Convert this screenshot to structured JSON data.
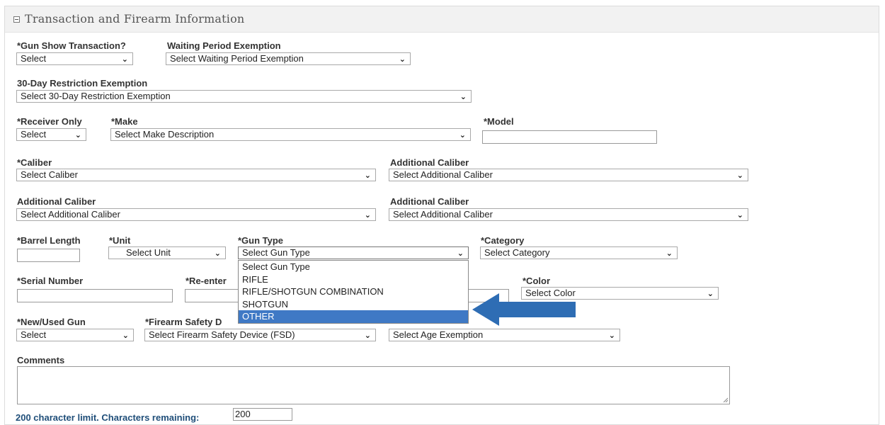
{
  "section": {
    "title": "Transaction and Firearm Information"
  },
  "fields": {
    "gun_show": {
      "label": "*Gun Show Transaction?",
      "value": "Select"
    },
    "waiting_period": {
      "label": "Waiting Period Exemption",
      "value": "Select Waiting Period Exemption"
    },
    "restriction_30": {
      "label": "30-Day Restriction Exemption",
      "value": "Select 30-Day Restriction Exemption"
    },
    "receiver_only": {
      "label": "*Receiver Only",
      "value": "Select"
    },
    "make": {
      "label": "*Make",
      "value": "Select Make Description"
    },
    "model": {
      "label": "*Model",
      "value": ""
    },
    "caliber": {
      "label": "*Caliber",
      "value": "Select Caliber"
    },
    "add_caliber_1": {
      "label": "Additional Caliber",
      "value": "Select Additional Caliber"
    },
    "add_caliber_2": {
      "label": "Additional Caliber",
      "value": "Select Additional Caliber"
    },
    "add_caliber_3": {
      "label": "Additional Caliber",
      "value": "Select Additional Caliber"
    },
    "barrel_length": {
      "label": "*Barrel Length",
      "value": ""
    },
    "unit": {
      "label": "*Unit",
      "value": "Select Unit"
    },
    "gun_type": {
      "label": "*Gun Type",
      "value": "Select Gun Type"
    },
    "category": {
      "label": "*Category",
      "value": "Select Category"
    },
    "serial": {
      "label": "*Serial Number",
      "value": ""
    },
    "reenter": {
      "label": "*Re-enter",
      "value": ""
    },
    "color": {
      "label": "*Color",
      "value": "Select Color"
    },
    "new_used": {
      "label": "*New/Used Gun",
      "value": "Select"
    },
    "fsd": {
      "label": "*Firearm Safety D",
      "value": "Select Firearm Safety Device (FSD)"
    },
    "age_exemption": {
      "value": "Select Age Exemption"
    },
    "comments": {
      "label": "Comments",
      "value": ""
    }
  },
  "gun_type_dropdown": {
    "options": [
      "Select Gun Type",
      "RIFLE",
      "RIFLE/SHOTGUN COMBINATION",
      "SHOTGUN",
      "OTHER"
    ],
    "highlighted": "OTHER"
  },
  "char_limit": {
    "label": "200 character limit. Characters remaining:",
    "remaining": "200"
  },
  "colors": {
    "highlight": "#3f79c5",
    "arrow": "#2e6db4",
    "limit_text": "#1f4e79"
  },
  "icons": {
    "collapse": "minus-square-icon",
    "chevron": "chevron-down-icon",
    "arrow": "arrow-left-icon"
  }
}
